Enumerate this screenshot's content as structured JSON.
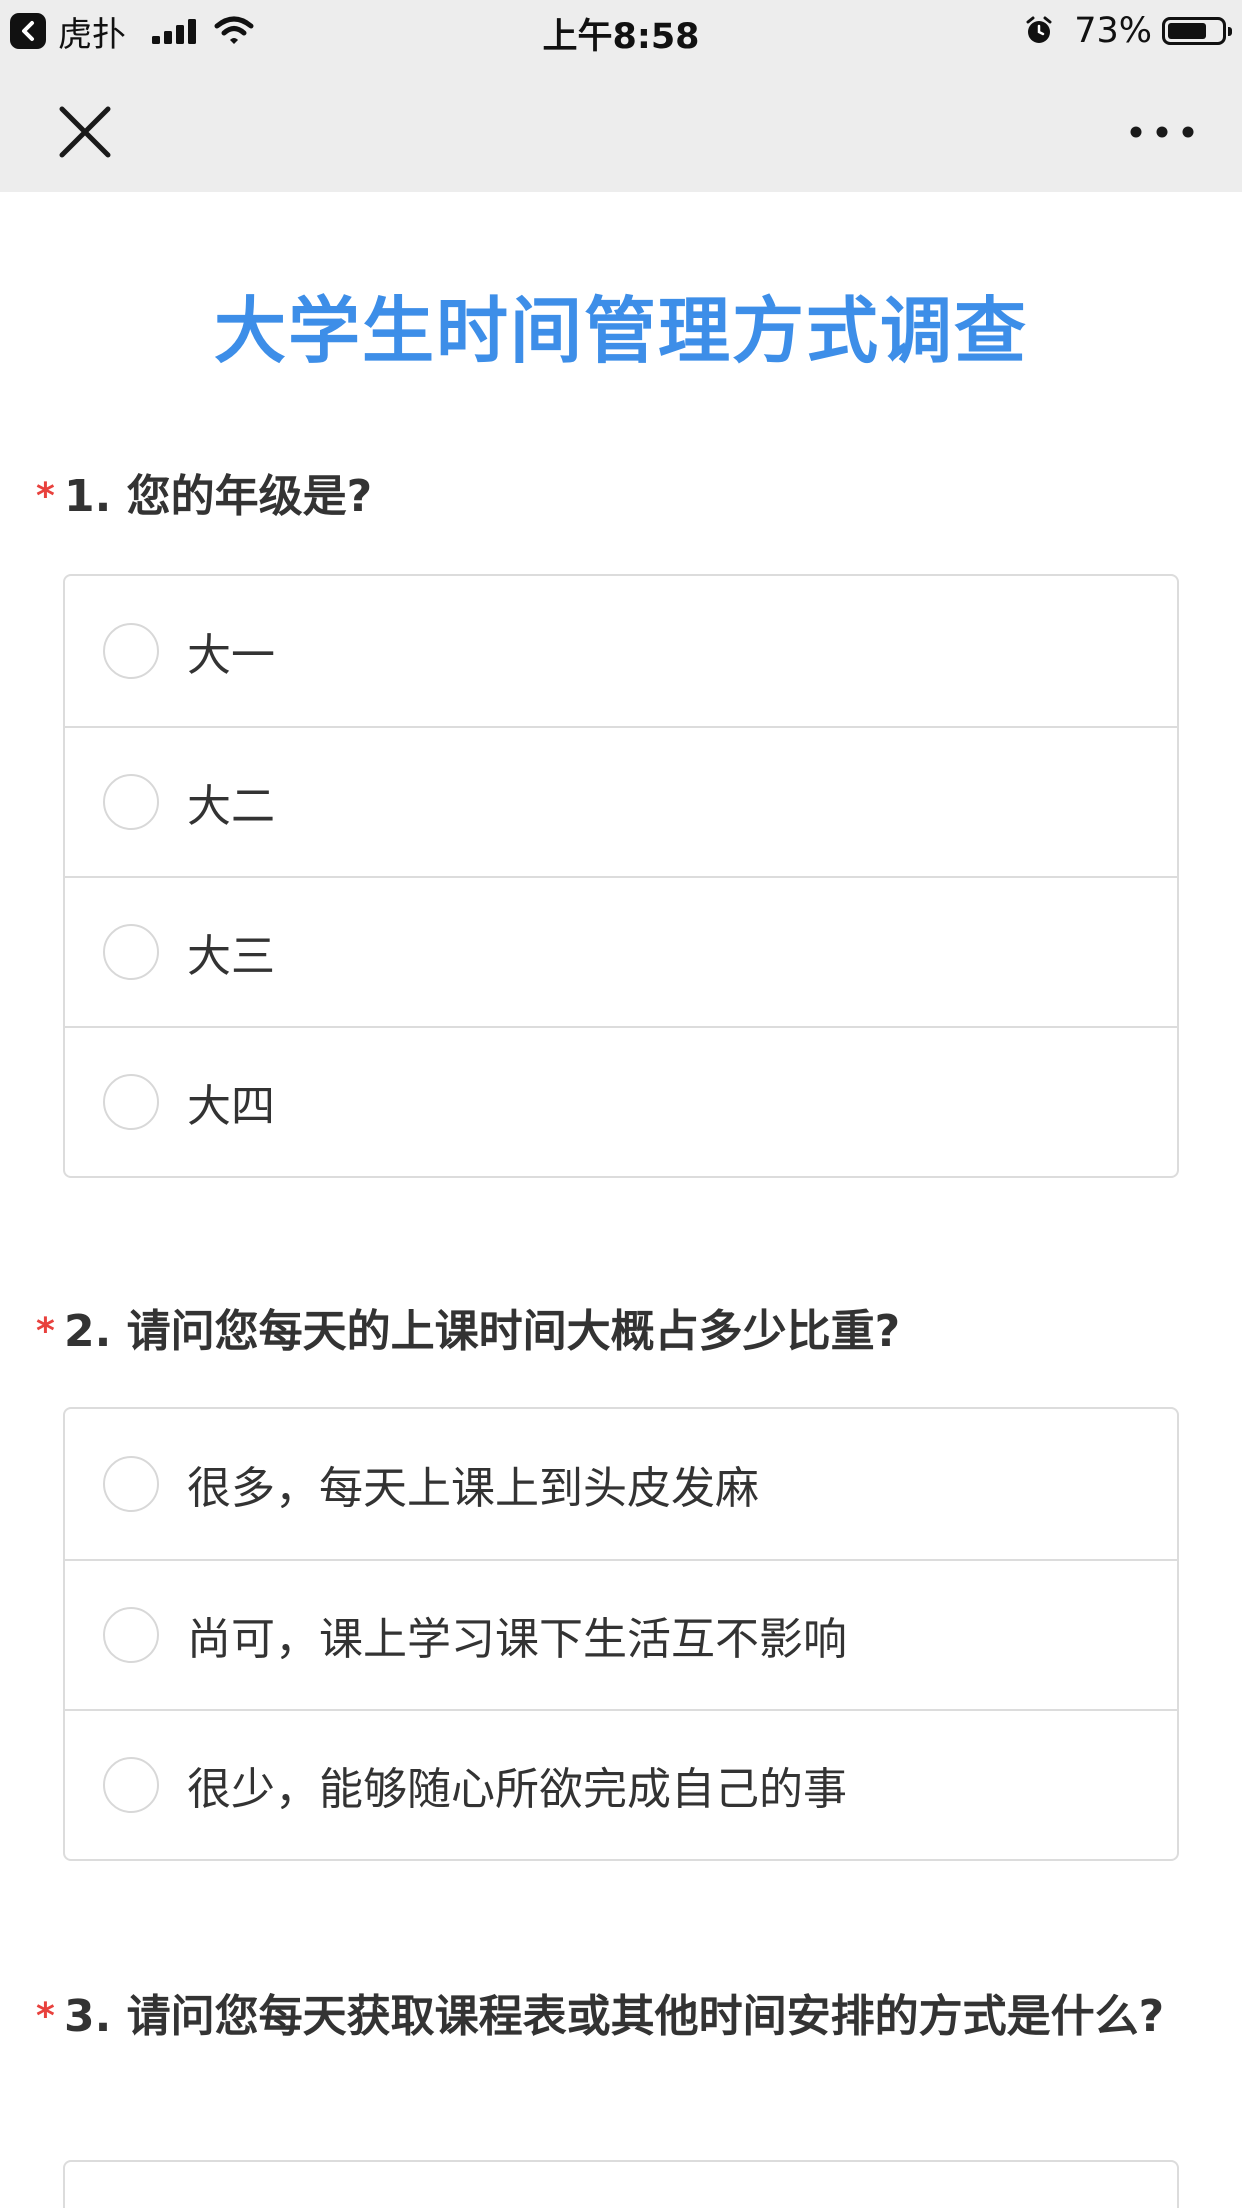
{
  "status_bar": {
    "app_name": "虎扑",
    "time": "上午8:58",
    "battery_percent": "73%",
    "battery_level": 0.73
  },
  "nav": {
    "close_icon": "close-icon",
    "more_icon": "more-icon"
  },
  "survey": {
    "title": "大学生时间管理方式调查",
    "required_mark": "*",
    "questions": [
      {
        "title": "1. 您的年级是?",
        "options": [
          "大一",
          "大二",
          "大三",
          "大四"
        ]
      },
      {
        "title": "2. 请问您每天的上课时间大概占多少比重?",
        "options": [
          "很多，每天上课上到头皮发麻",
          "尚可，课上学习课下生活互不影响",
          "很少，能够随心所欲完成自己的事"
        ]
      },
      {
        "title": "3. 请问您每天获取课程表或其他时间安排的方式是什么?",
        "options": []
      }
    ]
  },
  "colors": {
    "title_blue": "#3d8ee8",
    "required_red": "#e8413d",
    "nav_background": "#ededed",
    "border": "#dcdcdc"
  }
}
